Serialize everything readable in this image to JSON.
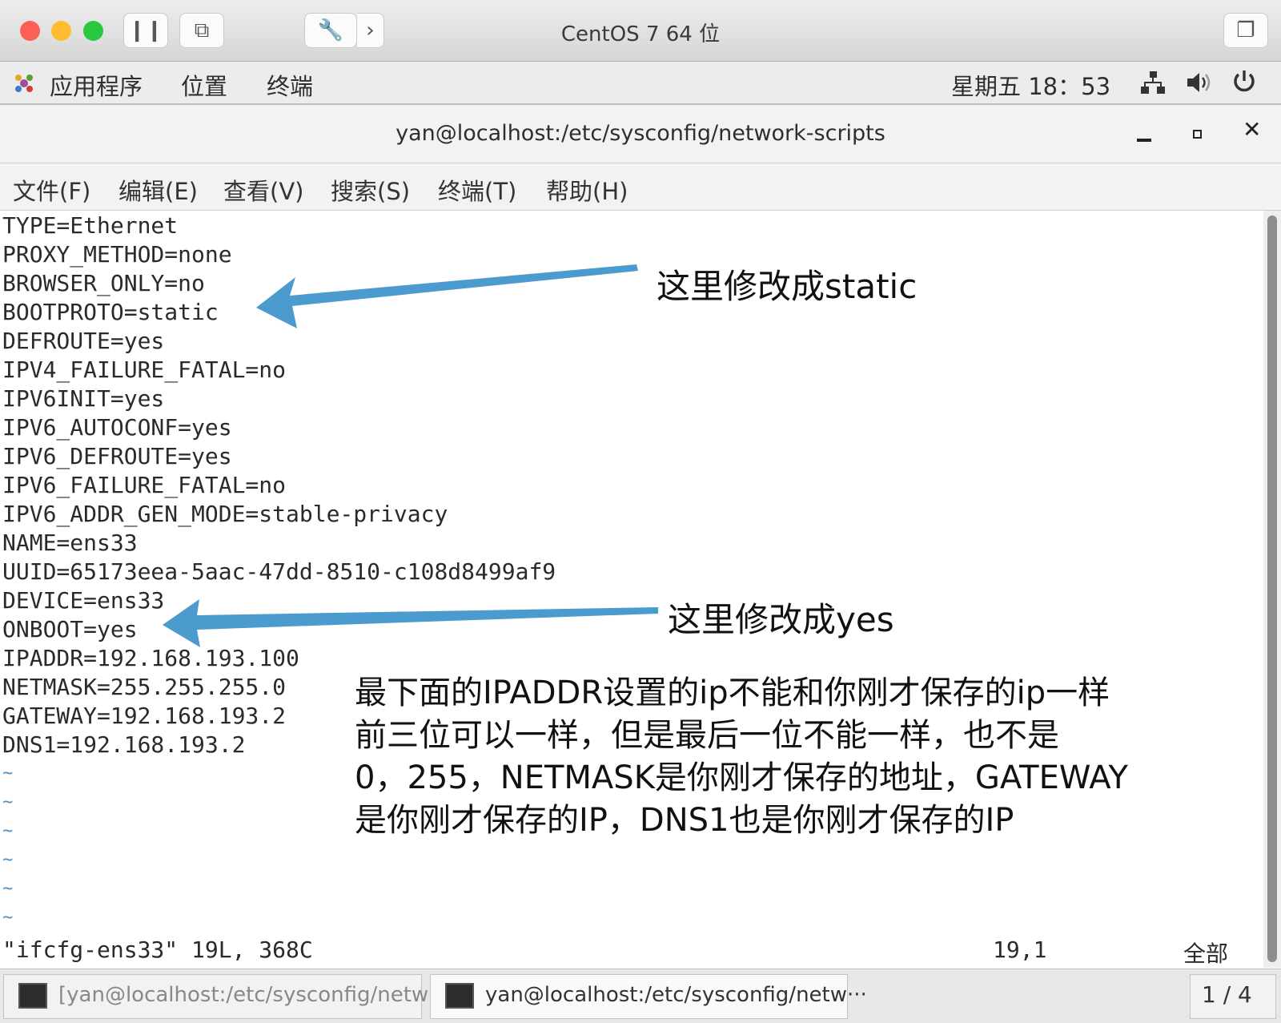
{
  "vm_window": {
    "title": "CentOS 7 64 位"
  },
  "top_panel": {
    "menus": [
      "应用程序",
      "位置",
      "终端"
    ],
    "clock": "星期五 18：53"
  },
  "terminal": {
    "title": "yan@localhost:/etc/sysconfig/network-scripts",
    "menus": [
      "文件(F)",
      "编辑(E)",
      "查看(V)",
      "搜索(S)",
      "终端(T)",
      "帮助(H)"
    ],
    "lines": [
      "TYPE=Ethernet",
      "PROXY_METHOD=none",
      "BROWSER_ONLY=no",
      "BOOTPROTO=static",
      "DEFROUTE=yes",
      "IPV4_FAILURE_FATAL=no",
      "IPV6INIT=yes",
      "IPV6_AUTOCONF=yes",
      "IPV6_DEFROUTE=yes",
      "IPV6_FAILURE_FATAL=no",
      "IPV6_ADDR_GEN_MODE=stable-privacy",
      "NAME=ens33",
      "UUID=65173eea-5aac-47dd-8510-c108d8499af9",
      "DEVICE=ens33",
      "ONBOOT=yes",
      "IPADDR=192.168.193.100",
      "NETMASK=255.255.255.0",
      "GATEWAY=192.168.193.2",
      "DNS1=192.168.193.2"
    ],
    "tilde": "~",
    "status_file": "\"ifcfg-ens33\" 19L, 368C",
    "status_pos": "19,1",
    "status_all": "全部"
  },
  "annotations": {
    "arrow1_text": "这里修改成static",
    "arrow2_text": "这里修改成yes",
    "note_lines": [
      "最下面的IPADDR设置的ip不能和你刚才保存的ip一样",
      "前三位可以一样，但是最后一位不能一样，也不是",
      "0，255，NETMASK是你刚才保存的地址，GATEWAY",
      "是你刚才保存的IP，DNS1也是你刚才保存的IP"
    ]
  },
  "taskbar": {
    "items": [
      "[yan@localhost:/etc/sysconfig/netw···",
      "yan@localhost:/etc/sysconfig/netw···"
    ],
    "workspace": "1 / 4"
  },
  "colors": {
    "arrow": "#4b9bcf",
    "tilde": "#4a90c8",
    "close": "#fd5f57",
    "minimize": "#febc2e",
    "zoom": "#2ac840"
  }
}
